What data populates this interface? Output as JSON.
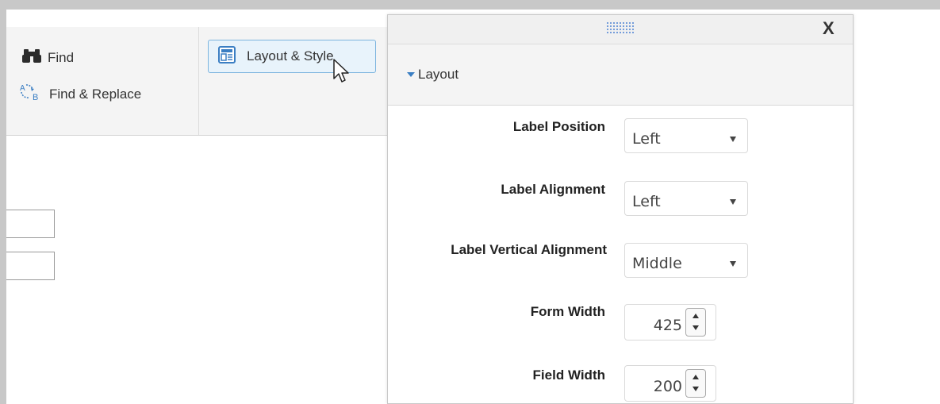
{
  "ribbon": {
    "find_label": "Find",
    "find_replace_label": "Find & Replace",
    "layout_style_label": "Layout & Style",
    "find_icon": "binoculars-icon",
    "find_replace_icon": "find-replace-icon",
    "layout_style_icon": "layout-style-icon"
  },
  "panel": {
    "close_label": "X",
    "section_title": "Layout",
    "accent_color": "#3a7ec3",
    "properties": {
      "label_position": {
        "label": "Label Position",
        "value": "Left"
      },
      "label_alignment": {
        "label": "Label Alignment",
        "value": "Left"
      },
      "label_vertical_alignment": {
        "label": "Label Vertical Alignment",
        "value": "Middle"
      },
      "form_width": {
        "label": "Form Width",
        "value": "425"
      },
      "field_width": {
        "label": "Field Width",
        "value": "200"
      }
    }
  }
}
